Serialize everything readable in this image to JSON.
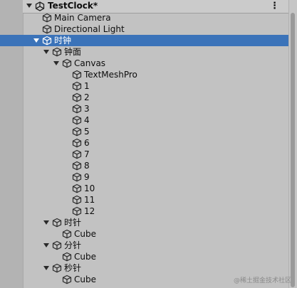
{
  "scene": {
    "name": "TestClock*",
    "menu_glyph": "⋮"
  },
  "rows": [
    {
      "label": "Main Camera",
      "depth": 0,
      "expanded": null,
      "selected": false
    },
    {
      "label": "Directional Light",
      "depth": 0,
      "expanded": null,
      "selected": false
    },
    {
      "label": "时钟",
      "depth": 0,
      "expanded": true,
      "selected": true
    },
    {
      "label": "钟面",
      "depth": 1,
      "expanded": true,
      "selected": false
    },
    {
      "label": "Canvas",
      "depth": 2,
      "expanded": true,
      "selected": false
    },
    {
      "label": "TextMeshPro",
      "depth": 3,
      "expanded": null,
      "selected": false
    },
    {
      "label": "1",
      "depth": 3,
      "expanded": null,
      "selected": false
    },
    {
      "label": "2",
      "depth": 3,
      "expanded": null,
      "selected": false
    },
    {
      "label": "3",
      "depth": 3,
      "expanded": null,
      "selected": false
    },
    {
      "label": "4",
      "depth": 3,
      "expanded": null,
      "selected": false
    },
    {
      "label": "5",
      "depth": 3,
      "expanded": null,
      "selected": false
    },
    {
      "label": "6",
      "depth": 3,
      "expanded": null,
      "selected": false
    },
    {
      "label": "7",
      "depth": 3,
      "expanded": null,
      "selected": false
    },
    {
      "label": "8",
      "depth": 3,
      "expanded": null,
      "selected": false
    },
    {
      "label": "9",
      "depth": 3,
      "expanded": null,
      "selected": false
    },
    {
      "label": "10",
      "depth": 3,
      "expanded": null,
      "selected": false
    },
    {
      "label": "11",
      "depth": 3,
      "expanded": null,
      "selected": false
    },
    {
      "label": "12",
      "depth": 3,
      "expanded": null,
      "selected": false
    },
    {
      "label": "时针",
      "depth": 1,
      "expanded": true,
      "selected": false
    },
    {
      "label": "Cube",
      "depth": 2,
      "expanded": null,
      "selected": false
    },
    {
      "label": "分针",
      "depth": 1,
      "expanded": true,
      "selected": false
    },
    {
      "label": "Cube",
      "depth": 2,
      "expanded": null,
      "selected": false
    },
    {
      "label": "秒针",
      "depth": 1,
      "expanded": true,
      "selected": false
    },
    {
      "label": "Cube",
      "depth": 2,
      "expanded": null,
      "selected": false
    }
  ],
  "icons": {
    "row_icon": "cube-icon",
    "scene_icon": "unity-icon"
  },
  "colors": {
    "selected_bg": "#3b73b9",
    "selected_text": "#ffffff",
    "panel_bg": "#c2c2c2"
  },
  "watermark": "@稀土掘金技术社区"
}
